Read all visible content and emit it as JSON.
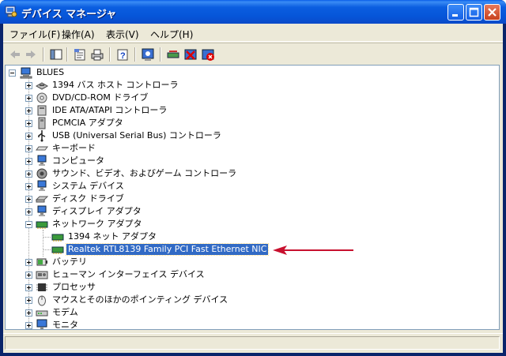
{
  "window": {
    "title": "デバイス マネージャ"
  },
  "menu": [
    "ファイル(F)",
    "操作(A)",
    "表示(V)",
    "ヘルプ(H)"
  ],
  "toolbar": {
    "icons": [
      "back-icon",
      "forward-icon",
      "show-hide-console-tree-icon",
      "properties-icon",
      "print-icon",
      "help-icon",
      "scan-hardware-icon",
      "update-driver-icon",
      "disable-device-icon",
      "uninstall-device-icon"
    ]
  },
  "tree": {
    "root": "BLUES",
    "items": [
      {
        "label": "1394 バス ホスト コントローラ",
        "icon": "1394-controller-icon"
      },
      {
        "label": "DVD/CD-ROM ドライブ",
        "icon": "cdrom-drive-icon"
      },
      {
        "label": "IDE ATA/ATAPI コントローラ",
        "icon": "ide-controller-icon"
      },
      {
        "label": "PCMCIA アダプタ",
        "icon": "pcmcia-adapter-icon"
      },
      {
        "label": "USB (Universal Serial Bus) コントローラ",
        "icon": "usb-icon"
      },
      {
        "label": "キーボード",
        "icon": "keyboard-icon"
      },
      {
        "label": "コンピュータ",
        "icon": "computer-icon"
      },
      {
        "label": "サウンド、ビデオ、およびゲーム コントローラ",
        "icon": "sound-icon"
      },
      {
        "label": "システム デバイス",
        "icon": "system-device-icon"
      },
      {
        "label": "ディスク ドライブ",
        "icon": "disk-drive-icon"
      },
      {
        "label": "ディスプレイ アダプタ",
        "icon": "display-adapter-icon"
      },
      {
        "label": "ネットワーク アダプタ",
        "icon": "network-adapter-icon",
        "expanded": true,
        "children": [
          {
            "label": "1394 ネット アダプタ",
            "icon": "network-card-icon"
          },
          {
            "label": "Realtek RTL8139 Family PCI Fast Ethernet NIC",
            "icon": "network-card-icon",
            "selected": true
          }
        ]
      },
      {
        "label": "バッテリ",
        "icon": "battery-icon"
      },
      {
        "label": "ヒューマン インターフェイス デバイス",
        "icon": "hid-icon"
      },
      {
        "label": "プロセッサ",
        "icon": "processor-icon"
      },
      {
        "label": "マウスとそのほかのポインティング デバイス",
        "icon": "mouse-icon"
      },
      {
        "label": "モデム",
        "icon": "modem-icon"
      },
      {
        "label": "モニタ",
        "icon": "monitor-icon"
      }
    ]
  },
  "colors": {
    "title_bar": "#0a5ee0",
    "selection": "#316ac5",
    "arrow": "#c8102e",
    "chrome": "#ece9d8"
  }
}
